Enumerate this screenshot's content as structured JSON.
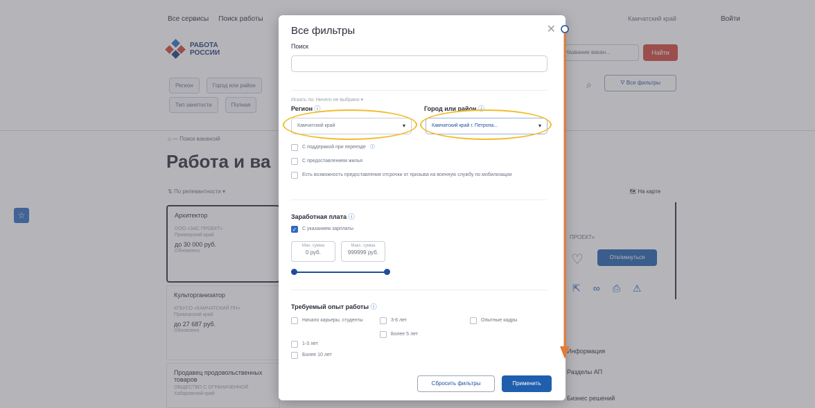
{
  "header": {
    "links": [
      "Все сервисы",
      "Поиск работы"
    ],
    "region": "Камчатский край",
    "login": "Войти",
    "logo_line1": "РАБОТА",
    "logo_line2": "РОССИИ",
    "search_select": "Название вакан...",
    "find_button": "Найти",
    "filter_chips": [
      "Регион",
      "Город или район"
    ],
    "filter_chips2": [
      "Тип занятости",
      "Полная"
    ],
    "all_filters_button": "Все фильтры"
  },
  "page": {
    "breadcrumb": "Поиск вакансий",
    "title": "Работа и ва",
    "sort": "По релевантности",
    "on_map": "На карте",
    "cards": [
      {
        "title": "Архитектор",
        "company": "ООО «ЗАС ПРОЕКТ»",
        "region": "Приморский край",
        "salary": "до 30 000 руб.",
        "date": "Обновлено"
      },
      {
        "title": "Культорганизатор",
        "company": "КГБУСО «КАМЧАТСКИЙ ПН»",
        "region": "Приморский край",
        "salary": "до 27 687 руб.",
        "date": "Обновлено"
      },
      {
        "title": "Продавец продовольственных товаров",
        "company": "ОБЩЕСТВО С ОГРАНИЧЕННОЙ",
        "region": "Хабаровский край",
        "salary": "",
        "date": ""
      }
    ],
    "right_panel_label": "ПРОЕКТ»",
    "respond_button": "Откликнуться",
    "side_links": [
      "Информация",
      "Разделы АП",
      "Бизнес решений"
    ]
  },
  "modal": {
    "title": "Все фильтры",
    "search_label": "Поиск",
    "search_in": "Искать по: Ничего не выбрано",
    "region_label": "Регион",
    "region_value": "Камчатский край",
    "city_label": "Город или район",
    "city_value": "Камчатский край г. Петропа...",
    "checkboxes": [
      "С поддержкой при переезде",
      "С предоставлением жилья",
      "Есть возможность предоставления отсрочки от призыва на военную службу по мобилизации"
    ],
    "salary_label": "Заработная плата",
    "salary_checkbox": "С указанием зарплаты",
    "min_caption": "Мин. сумма",
    "min_value": "0 руб.",
    "max_caption": "Макс. сумма",
    "max_value": "999999 руб.",
    "experience_label": "Требуемый опыт работы",
    "experience_options": [
      "Начало карьеры, студенты",
      "3-6 лет",
      "Опытные кадры",
      "Более 5 лет",
      "1-3 лет",
      "Более 10 лет"
    ],
    "reset_button": "Сбросить фильтры",
    "apply_button": "Применить"
  },
  "annotation_colors": {
    "highlight": "#f2bd2a",
    "arrow": "#e07a3a"
  }
}
